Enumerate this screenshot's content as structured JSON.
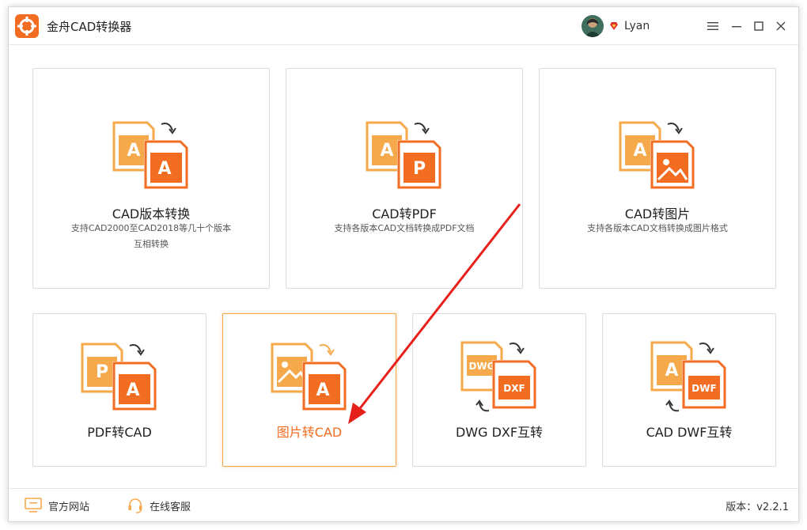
{
  "app": {
    "title": "金舟CAD转换器"
  },
  "user": {
    "name": "Lyan"
  },
  "cards_top": [
    {
      "title": "CAD版本转换",
      "desc_line1": "支持CAD2000至CAD2018等几十个版本",
      "desc_line2": "互相转换"
    },
    {
      "title": "CAD转PDF",
      "desc_line1": "支持各版本CAD文档转换成PDF文档",
      "desc_line2": ""
    },
    {
      "title": "CAD转图片",
      "desc_line1": "支持各版本CAD文档转换成图片格式",
      "desc_line2": ""
    }
  ],
  "cards_bottom": [
    {
      "title": "PDF转CAD"
    },
    {
      "title": "图片转CAD"
    },
    {
      "title": "DWG DXF互转"
    },
    {
      "title": "CAD DWF互转"
    }
  ],
  "icon_text": {
    "a": "A",
    "p": "P",
    "dwg": "DWG",
    "dxf": "DXF",
    "dwf": "DWF"
  },
  "footer": {
    "website": "官方网站",
    "support": "在线客服",
    "version": "版本：v2.2.1"
  },
  "colors": {
    "accent": "#f26d21",
    "orange_light": "#f6a94a",
    "annotation_red": "#e8201c"
  }
}
